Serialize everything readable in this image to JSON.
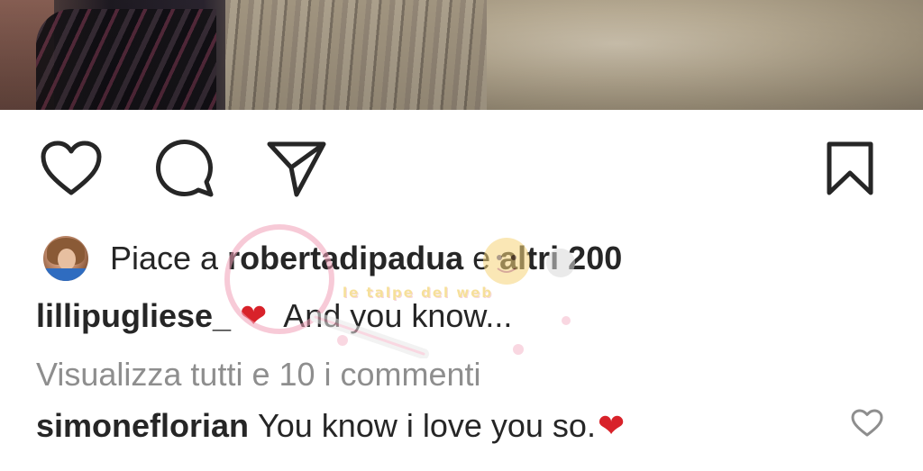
{
  "post": {
    "likes": {
      "prefix": "Piace a",
      "user": "robertadipadua",
      "connector": "e",
      "others": "altri 200"
    },
    "caption": {
      "username": "lillipugliese_",
      "emoji": "❤",
      "text": "And you know..."
    },
    "view_all_comments": "Visualizza tutti e 10 i commenti",
    "comment": {
      "username": "simoneflorian",
      "text": "You know i love you so.",
      "emoji": "❤"
    }
  },
  "watermark": {
    "text": "le talpe del web"
  },
  "icons": {
    "like": "heart-outline-icon",
    "comment": "comment-bubble-icon",
    "share": "paper-plane-icon",
    "save": "bookmark-icon",
    "comment_like": "heart-outline-small-icon"
  },
  "colors": {
    "text": "#262626",
    "muted": "#8e8e8e",
    "heart": "#d8222a",
    "background": "#ffffff"
  }
}
